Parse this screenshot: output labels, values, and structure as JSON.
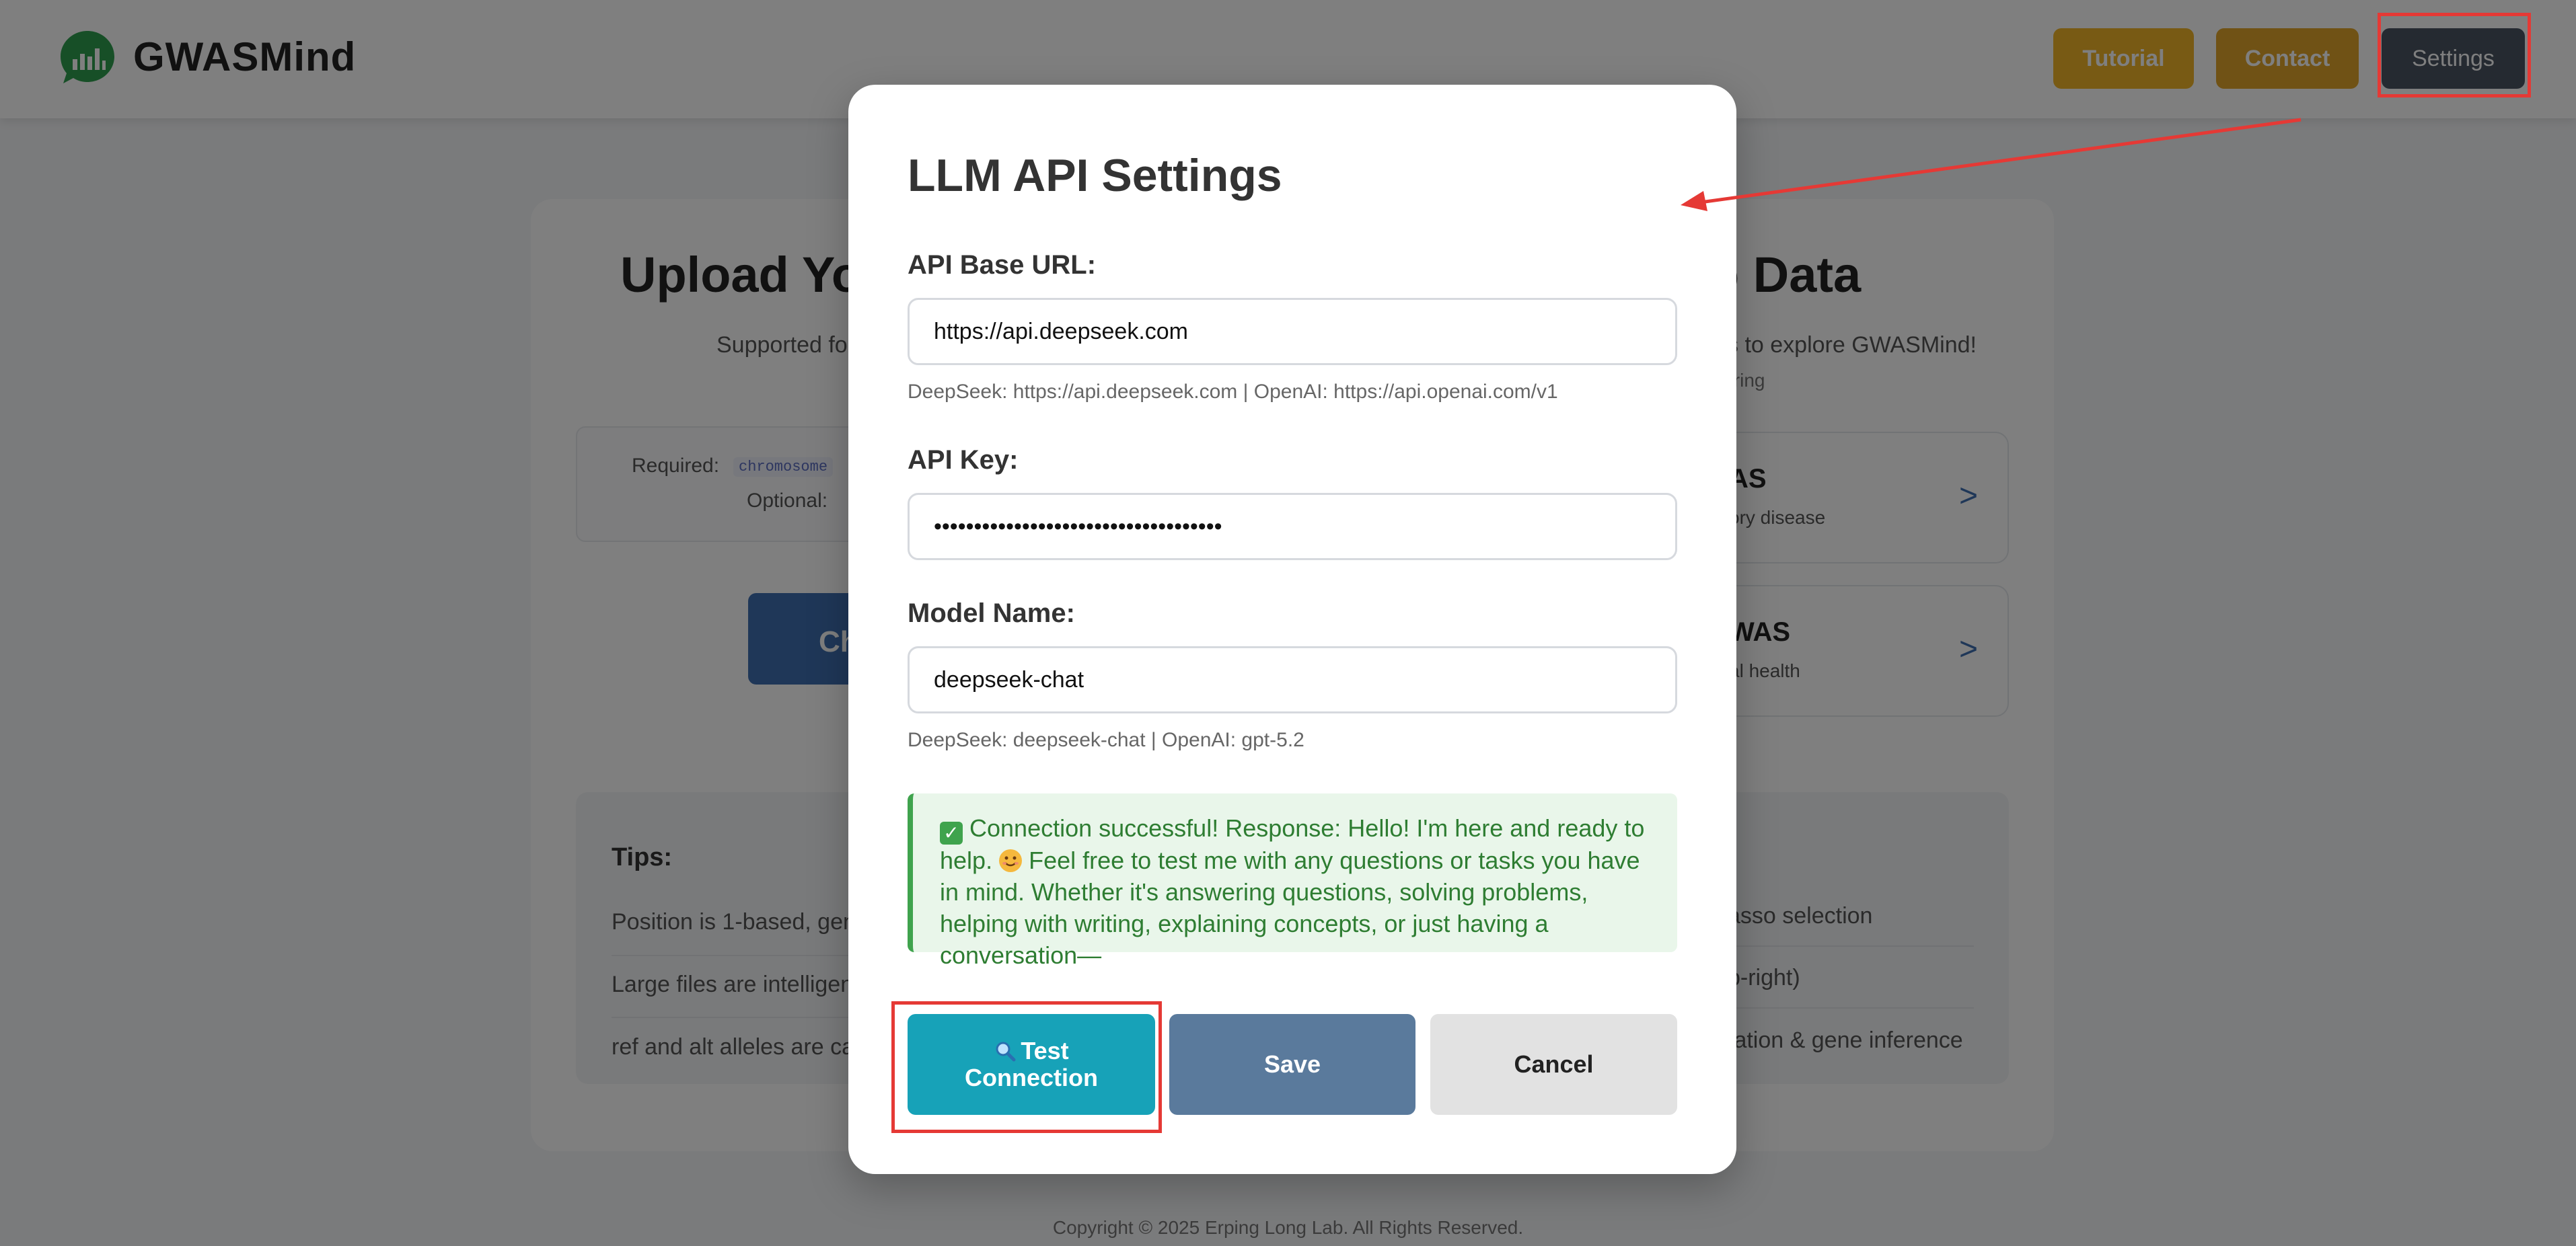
{
  "app": {
    "name": "GWASMind",
    "nav": {
      "tutorial": "Tutorial",
      "contact": "Contact",
      "settings": "Settings"
    }
  },
  "background": {
    "upload_title": "Upload Yo",
    "upload_subtitle": "Supported fo",
    "demo_title": "o Data",
    "demo_subtitle": "s to explore GWASMind!",
    "demo_small": "loring",
    "required_label": "Required:",
    "required_chip": "chromosome",
    "optional_label": "Optional:",
    "choose_button": "Ch",
    "examples": [
      {
        "title": "AS",
        "subtitle": "ory disease",
        "arrow": ">"
      },
      {
        "title": "WAS",
        "subtitle": "al health",
        "arrow": ">"
      }
    ],
    "tips_title": "Tips:",
    "tips_left": [
      "Position is 1-based, gen",
      "Large files are intelligen",
      "ref and alt alleles are cas"
    ],
    "tips_right": [
      "asso selection",
      "p-right)",
      "tation & gene inference"
    ],
    "copyright": "Copyright © 2025 Erping Long Lab. All Rights Reserved."
  },
  "modal": {
    "title": "LLM API Settings",
    "base_url_label": "API Base URL:",
    "base_url_value": "https://api.deepseek.com",
    "base_url_hint": "DeepSeek: https://api.deepseek.com | OpenAI: https://api.openai.com/v1",
    "api_key_label": "API Key:",
    "api_key_value": "sk-xxxxxxxxxxxxxxxxxxxxxxxxxxxxxxxxx",
    "model_label": "Model Name:",
    "model_value": "deepseek-chat",
    "model_hint": "DeepSeek: deepseek-chat | OpenAI: gpt-5.2",
    "success_part1": "Connection successful! Response: Hello! I'm here and ready to help.",
    "success_part2": "Feel free to test me with any questions or tasks you have in mind. Whether it's answering questions, solving problems, helping with writing, explaining concepts, or just having a conversation—",
    "buttons": {
      "test": "Test Connection",
      "save": "Save",
      "cancel": "Cancel"
    }
  },
  "colors": {
    "success_green": "#2e7d32",
    "test_button": "#17a2b8",
    "save_button": "#5a7a9c",
    "annotation_red": "#e53935"
  }
}
